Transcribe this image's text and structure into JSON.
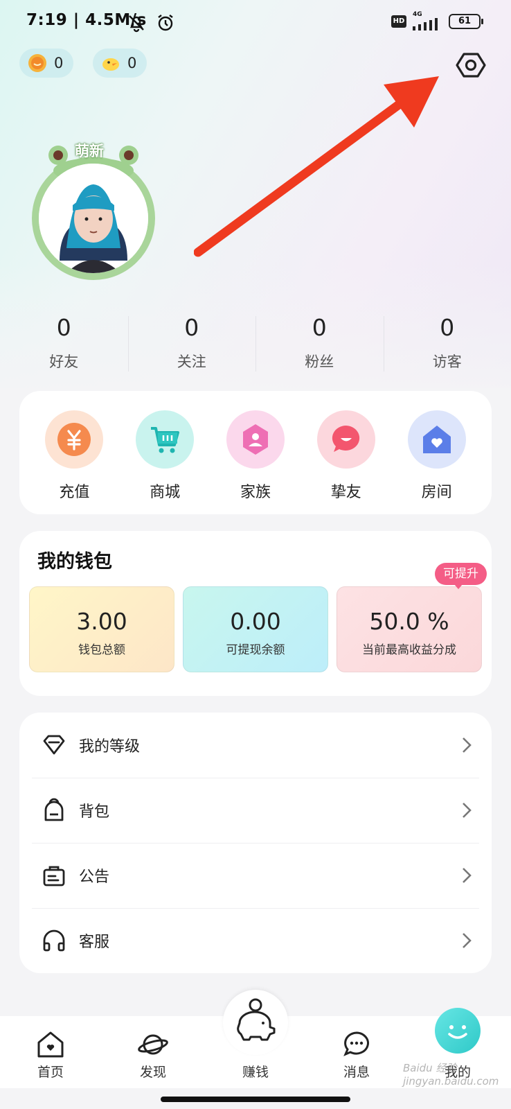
{
  "status_bar": {
    "time": "7:19 | 4.5M/s",
    "hd": "HD",
    "network": "4G",
    "battery": "61"
  },
  "currency": [
    {
      "icon": "gold-coin-icon",
      "amount": "0"
    },
    {
      "icon": "duck-coin-icon",
      "amount": "0"
    }
  ],
  "profile": {
    "avatar_tag": "萌新"
  },
  "stats": [
    {
      "value": "0",
      "label": "好友"
    },
    {
      "value": "0",
      "label": "关注"
    },
    {
      "value": "0",
      "label": "粉丝"
    },
    {
      "value": "0",
      "label": "访客"
    }
  ],
  "quick_actions": [
    {
      "label": "充值",
      "icon": "yen-icon"
    },
    {
      "label": "商城",
      "icon": "cart-icon"
    },
    {
      "label": "家族",
      "icon": "family-icon"
    },
    {
      "label": "挚友",
      "icon": "chat-heart-icon"
    },
    {
      "label": "房间",
      "icon": "home-heart-icon"
    }
  ],
  "wallet": {
    "title": "我的钱包",
    "promote_badge": "可提升",
    "items": [
      {
        "value": "3.00",
        "label": "钱包总额"
      },
      {
        "value": "0.00",
        "label": "可提现余额"
      },
      {
        "value": "50.0 %",
        "label": "当前最高收益分成"
      }
    ]
  },
  "menu": [
    {
      "label": "我的等级",
      "icon": "diamond-icon"
    },
    {
      "label": "背包",
      "icon": "backpack-icon"
    },
    {
      "label": "公告",
      "icon": "notice-icon"
    },
    {
      "label": "客服",
      "icon": "headset-icon"
    }
  ],
  "nav": [
    {
      "label": "首页",
      "icon": "home-icon"
    },
    {
      "label": "发现",
      "icon": "planet-icon"
    },
    {
      "label": "赚钱",
      "icon": "piggy-bank-icon"
    },
    {
      "label": "消息",
      "icon": "message-icon"
    },
    {
      "label": "我的",
      "icon": "smiley-icon"
    }
  ],
  "watermark": "Baidu 经验 jingyan.baidu.com"
}
